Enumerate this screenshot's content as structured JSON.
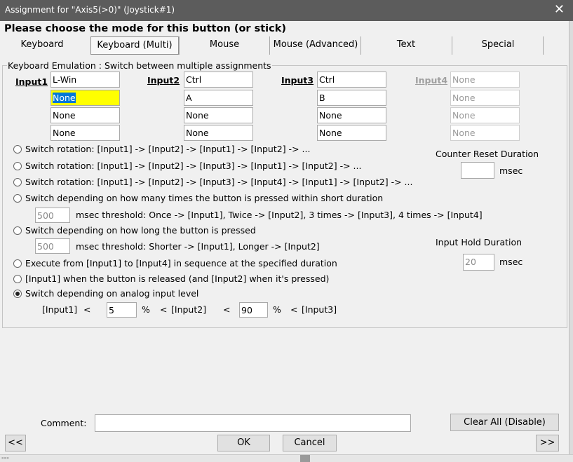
{
  "window": {
    "title": "Assignment for \"Axis5(>0)\" (Joystick#1)",
    "close_glyph": "✕"
  },
  "heading": "Please choose the mode for this button (or stick)",
  "tabs": [
    "Keyboard",
    "Keyboard (Multi)",
    "Mouse",
    "Mouse (Advanced)",
    "Text",
    "Special"
  ],
  "selected_tab": "Keyboard (Multi)",
  "group_label": "Keyboard Emulation : Switch between multiple assignments",
  "inputs": {
    "input1": {
      "label": "Input1",
      "values": [
        "L-Win",
        "None",
        "None",
        "None"
      ]
    },
    "input2": {
      "label": "Input2",
      "values": [
        "Ctrl",
        "A",
        "None",
        "None"
      ]
    },
    "input3": {
      "label": "Input3",
      "values": [
        "Ctrl",
        "B",
        "None",
        "None"
      ]
    },
    "input4": {
      "label": "Input4",
      "values": [
        "None",
        "None",
        "None",
        "None"
      ]
    }
  },
  "options": [
    "Switch rotation: [Input1] -> [Input2] -> [Input1] -> [Input2] -> ...",
    "Switch rotation: [Input1] -> [Input2] -> [Input3] -> [Input1] -> [Input2] -> ...",
    "Switch rotation: [Input1] -> [Input2] -> [Input3] -> [Input4] -> [Input1] -> [Input2] -> ...",
    "Switch depending on how many times the button is pressed within short duration",
    "Switch depending on how long the button is pressed",
    "Execute from [Input1] to [Input4] in sequence at the specified duration",
    "[Input1] when the button is released (and [Input2] when it's pressed)",
    "Switch depending on analog input level"
  ],
  "selected_option": "Switch depending on analog input level",
  "press_count": {
    "value": "500",
    "text": "msec threshold: Once -> [Input1], Twice -> [Input2], 3 times -> [Input3], 4 times -> [Input4]"
  },
  "press_length": {
    "value": "500",
    "text": "msec threshold: Shorter -> [Input1], Longer -> [Input2]"
  },
  "counter_reset": {
    "label": "Counter Reset Duration",
    "value": "",
    "unit": "msec"
  },
  "hold_duration": {
    "label": "Input Hold Duration",
    "value": "20",
    "unit": "msec"
  },
  "analog": {
    "input1": "[Input1]",
    "lt1": "<",
    "value1": "5",
    "pct1": "%",
    "lt2": "<",
    "input2": "[Input2]",
    "lt3": "<",
    "value2": "90",
    "pct2": "%",
    "lt4": "<",
    "input3": "[Input3]"
  },
  "comment": {
    "label": "Comment:",
    "value": ""
  },
  "buttons": {
    "clear": "Clear All (Disable)",
    "prev": "<<",
    "ok": "OK",
    "cancel": "Cancel",
    "next": ">>"
  },
  "status_mark": "---"
}
